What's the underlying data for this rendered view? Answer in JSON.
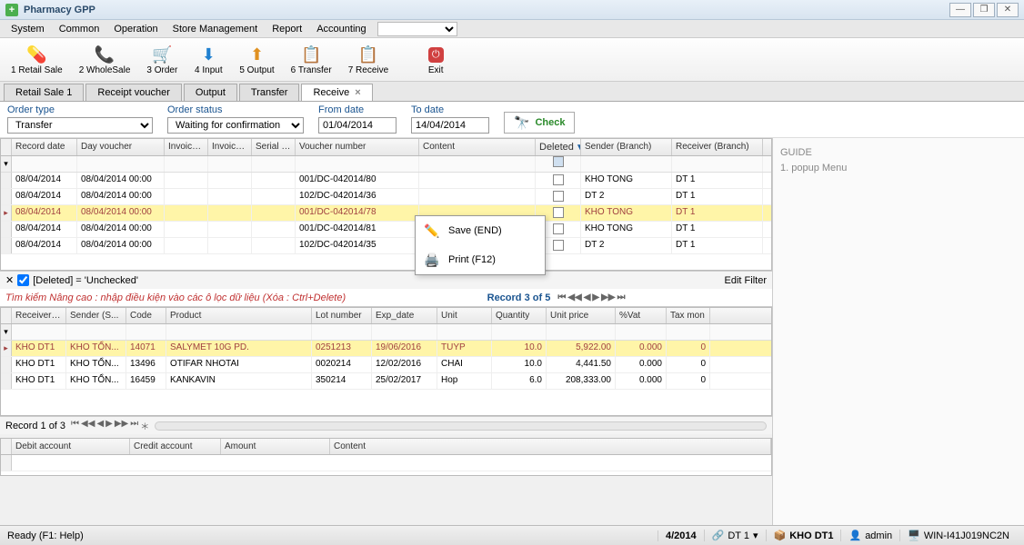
{
  "window": {
    "title": "Pharmacy GPP"
  },
  "menu": {
    "items": [
      "System",
      "Common",
      "Operation",
      "Store Management",
      "Report",
      "Accounting"
    ]
  },
  "toolbar": [
    {
      "label": "1 Retail Sale",
      "icon": "pill-icon"
    },
    {
      "label": "2 WholeSale",
      "icon": "phone-icon"
    },
    {
      "label": "3 Order",
      "icon": "cart-icon"
    },
    {
      "label": "4 Input",
      "icon": "input-icon"
    },
    {
      "label": "5 Output",
      "icon": "output-icon"
    },
    {
      "label": "6 Transfer",
      "icon": "transfer-icon"
    },
    {
      "label": "7 Receive",
      "icon": "receive-icon"
    },
    {
      "label": "Exit",
      "icon": "exit-icon"
    }
  ],
  "tabs": [
    "Retail Sale 1",
    "Receipt voucher",
    "Output",
    "Transfer",
    "Receive"
  ],
  "active_tab": "Receive",
  "filters": {
    "order_type_label": "Order type",
    "order_type_value": "Transfer",
    "order_status_label": "Order status",
    "order_status_value": "Waiting for confirmation",
    "from_date_label": "From date",
    "from_date_value": "01/04/2014",
    "to_date_label": "To date",
    "to_date_value": "14/04/2014",
    "check_label": "Check"
  },
  "top_grid": {
    "columns": [
      "Record date",
      "Day voucher",
      "Invoice...",
      "Invoice...",
      "Serial n...",
      "Voucher number",
      "Content",
      "Deleted",
      "Sender (Branch)",
      "Receiver (Branch)"
    ],
    "rows": [
      {
        "record": "08/04/2014",
        "day": "08/04/2014 00:00",
        "voucher": "001/DC-042014/80",
        "sender": "KHO TONG",
        "receiver": "DT 1"
      },
      {
        "record": "08/04/2014",
        "day": "08/04/2014 00:00",
        "voucher": "102/DC-042014/36",
        "sender": "DT 2",
        "receiver": "DT 1"
      },
      {
        "record": "08/04/2014",
        "day": "08/04/2014 00:00",
        "voucher": "001/DC-042014/78",
        "sender": "KHO TONG",
        "receiver": "DT 1",
        "selected": true
      },
      {
        "record": "08/04/2014",
        "day": "08/04/2014 00:00",
        "voucher": "001/DC-042014/81",
        "sender": "KHO TONG",
        "receiver": "DT 1"
      },
      {
        "record": "08/04/2014",
        "day": "08/04/2014 00:00",
        "voucher": "102/DC-042014/35",
        "sender": "DT 2",
        "receiver": "DT 1"
      }
    ]
  },
  "filterbar": {
    "text": "[Deleted] = 'Unchecked'",
    "edit": "Edit Filter"
  },
  "advbar": {
    "hint": "Tìm kiếm Nâng cao : nhập điều kiện vào các ô lọc dữ liệu (Xóa : Ctrl+Delete)",
    "record": "Record 3 of 5"
  },
  "detail_grid": {
    "columns": [
      "Receiver (...",
      "Sender (S...",
      "Code",
      "Product",
      "Lot number",
      "Exp_date",
      "Unit",
      "Quantity",
      "Unit price",
      "%Vat",
      "Tax mon"
    ],
    "rows": [
      {
        "recv": "KHO DT1",
        "send": "KHO TỔN...",
        "code": "14071",
        "product": "SALYMET 10G PD.",
        "lot": "0251213",
        "exp": "19/06/2016",
        "unit": "TUYP",
        "qty": "10.0",
        "price": "5,922.00",
        "vat": "0.000",
        "tax": "0",
        "selected": true
      },
      {
        "recv": "KHO DT1",
        "send": "KHO TỔN...",
        "code": "13496",
        "product": "OTIFAR NHOTAI",
        "lot": "0020214",
        "exp": "12/02/2016",
        "unit": "CHAI",
        "qty": "10.0",
        "price": "4,441.50",
        "vat": "0.000",
        "tax": "0"
      },
      {
        "recv": "KHO DT1",
        "send": "KHO TỔN...",
        "code": "16459",
        "product": "KANKAVIN",
        "lot": "350214",
        "exp": "25/02/2017",
        "unit": "Hop",
        "qty": "6.0",
        "price": "208,333.00",
        "vat": "0.000",
        "tax": "0"
      }
    ]
  },
  "pager": {
    "text": "Record 1 of 3"
  },
  "bottom_grid": {
    "columns": [
      "Debit account",
      "Credit account",
      "Amount",
      "Content"
    ]
  },
  "popup": [
    {
      "label": "Save (END)",
      "icon": "pencil-icon"
    },
    {
      "label": "Print (F12)",
      "icon": "printer-icon"
    }
  ],
  "guide": {
    "title": "GUIDE",
    "item": "1. popup Menu"
  },
  "status": {
    "ready": "Ready (F1: Help)",
    "period": "4/2014",
    "branch1": "DT 1",
    "branch2": "KHO DT1",
    "user": "admin",
    "machine": "WIN-I41J019NC2N"
  }
}
